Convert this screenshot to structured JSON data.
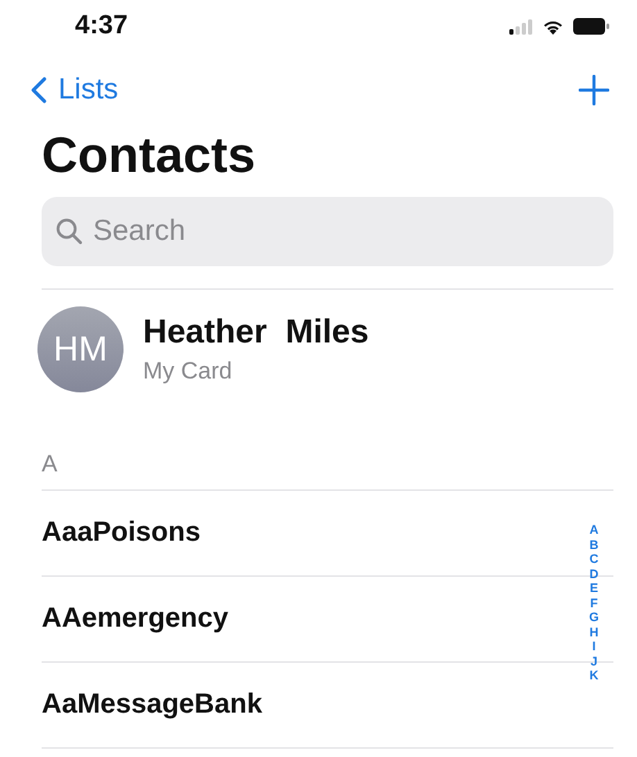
{
  "status_bar": {
    "time": "4:37"
  },
  "nav": {
    "back_label": "Lists"
  },
  "title": "Contacts",
  "search": {
    "placeholder": "Search"
  },
  "my_card": {
    "initials": "HM",
    "name": "Heather  Miles",
    "subtitle": "My Card"
  },
  "sections": [
    {
      "header": "A",
      "rows": [
        "AaaPoisons",
        "AAemergency",
        "AaMessageBank"
      ]
    }
  ],
  "index": [
    "A",
    "B",
    "C",
    "D",
    "E",
    "F",
    "G",
    "H",
    "I",
    "J",
    "K"
  ]
}
